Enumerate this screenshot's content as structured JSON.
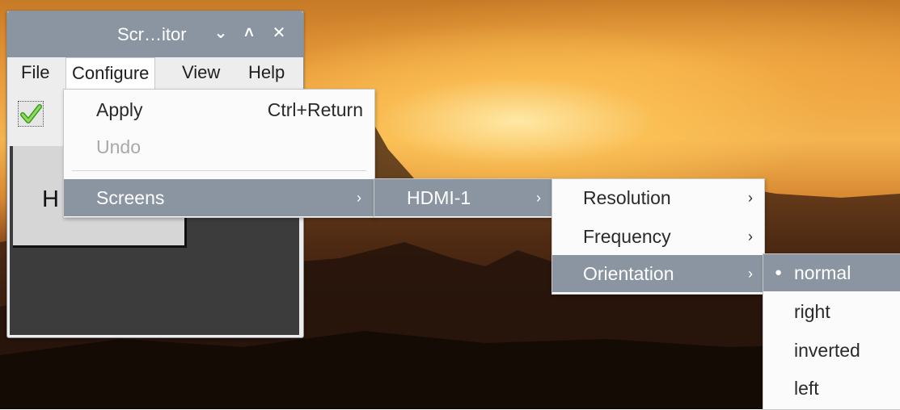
{
  "window": {
    "title": "Scr…itor",
    "buttons": {
      "minimize": "⌄",
      "maximize": "˄",
      "close": "✕"
    }
  },
  "menubar": {
    "items": [
      "File",
      "Configure",
      "View",
      "Help"
    ],
    "active": "Configure"
  },
  "toolbar": {
    "apply_icon": "check-icon"
  },
  "canvas": {
    "monitor_label": "H"
  },
  "configure_menu": {
    "apply": {
      "label": "Apply",
      "shortcut": "Ctrl+Return"
    },
    "undo": {
      "label": "Undo"
    },
    "screens": {
      "label": "Screens",
      "arrow": "›"
    }
  },
  "screens_menu": {
    "hdmi1": {
      "label": "HDMI-1",
      "arrow": "›"
    }
  },
  "hdmi_menu": {
    "resolution": {
      "label": "Resolution",
      "arrow": "›"
    },
    "frequency": {
      "label": "Frequency",
      "arrow": "›"
    },
    "orientation": {
      "label": "Orientation",
      "arrow": "›"
    }
  },
  "orientation_menu": {
    "bullet": "●",
    "items": [
      "normal",
      "right",
      "inverted",
      "left"
    ],
    "selected": "normal"
  },
  "colors": {
    "highlight": "#8a95a1",
    "titlebar": "#8a95a1",
    "canvas": "#3c3c3c"
  }
}
